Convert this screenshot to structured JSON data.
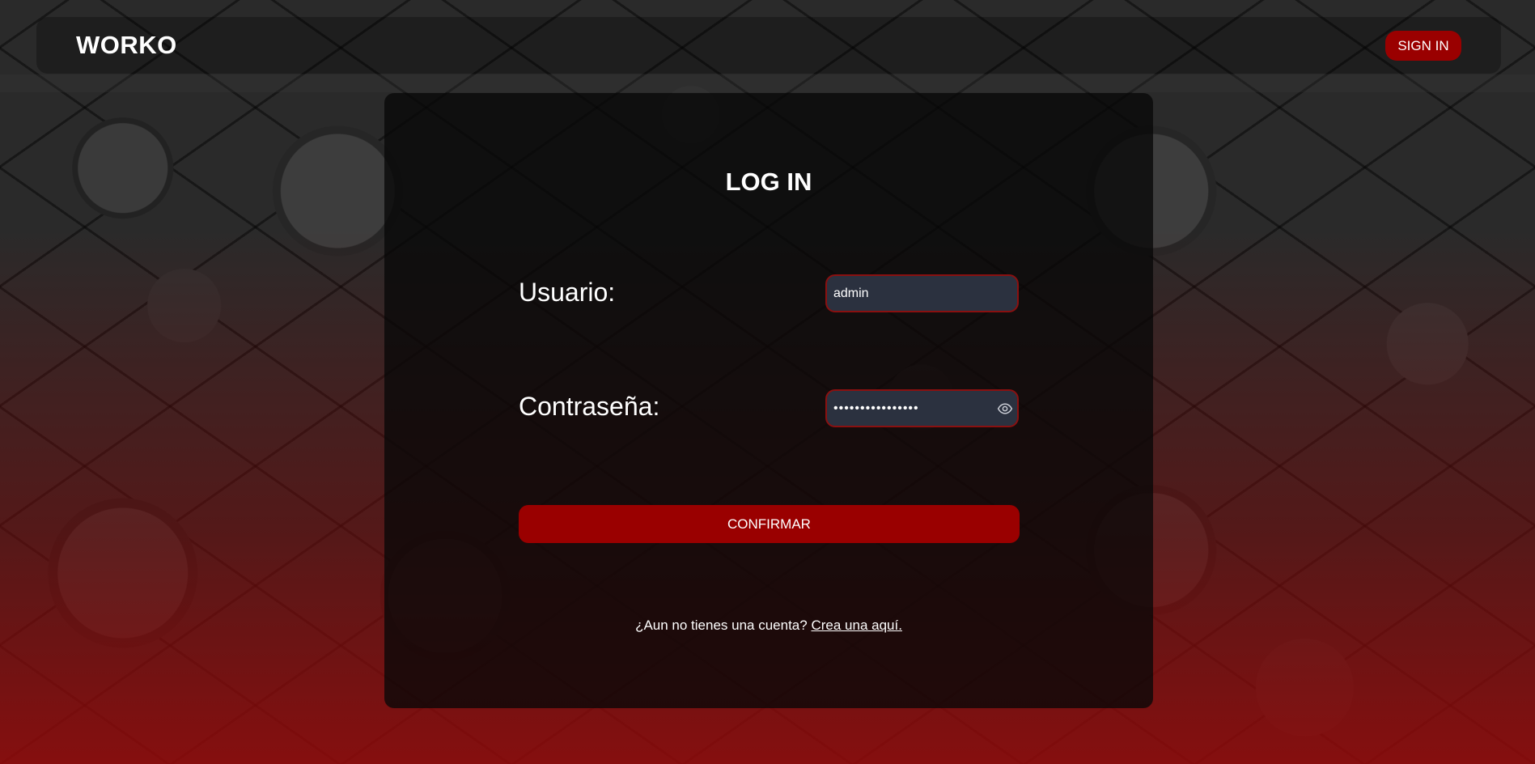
{
  "header": {
    "brand": "WORKO",
    "signin_label": "SIGN IN"
  },
  "login": {
    "title": "LOG IN",
    "username_label": "Usuario:",
    "username_value": "admin",
    "password_label": "Contraseña:",
    "password_value": "••••••••••••••••",
    "confirm_label": "CONFIRMAR",
    "register_prompt": "¿Aun no tienes una cuenta?",
    "register_link": "Crea una aquí."
  },
  "icons": {
    "password_toggle": "eye-icon"
  },
  "colors": {
    "accent": "#9a0000",
    "input_bg": "#2b313f",
    "input_border": "#8a1010",
    "text": "#ffffff"
  }
}
